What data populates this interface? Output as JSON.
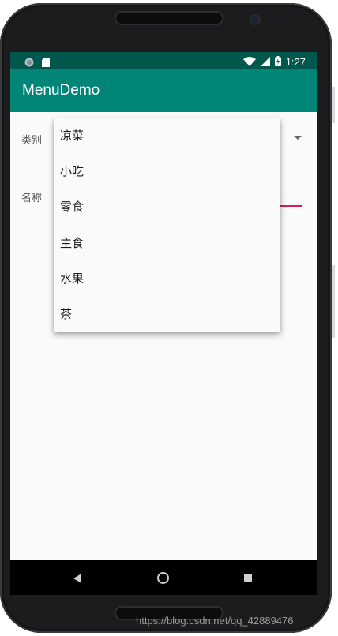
{
  "statusbar": {
    "time": "1:27",
    "left_icons": [
      "sync-icon",
      "sd-card-icon"
    ],
    "right_icons": [
      "wifi-icon",
      "signal-icon",
      "battery-icon"
    ]
  },
  "appbar": {
    "title": "MenuDemo"
  },
  "form": {
    "category_label": "类别",
    "name_label": "名称"
  },
  "dropdown": {
    "options": [
      "凉菜",
      "小吃",
      "零食",
      "主食",
      "水果",
      "茶"
    ]
  },
  "watermark": "https://blog.csdn.net/qq_42889476",
  "colors": {
    "statusbar": "#00574b",
    "appbar": "#008577",
    "accent": "#d81b60"
  }
}
